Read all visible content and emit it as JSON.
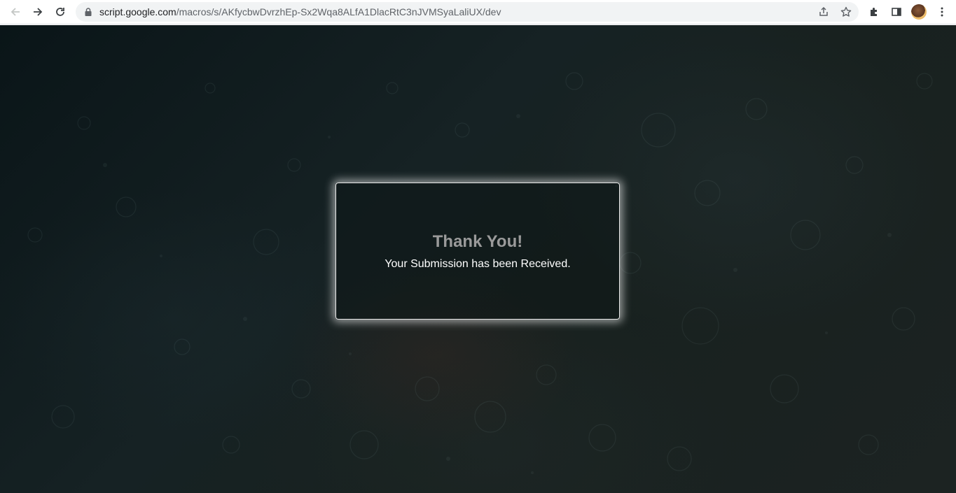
{
  "browser": {
    "url_host": "script.google.com",
    "url_path": "/macros/s/AKfycbwDvrzhEp-Sx2Wqa8ALfA1DlacRtC3nJVMSyaLaliUX/dev",
    "icons": [
      "back-arrow-icon",
      "forward-arrow-icon",
      "reload-icon",
      "lock-icon",
      "share-icon",
      "star-icon",
      "extensions-icon",
      "side-panel-icon",
      "avatar",
      "more-vert-icon"
    ]
  },
  "card": {
    "title": "Thank You!",
    "message": "Your Submission has been Received."
  },
  "colors": {
    "title": "#9a9a9a",
    "message": "#ffffff",
    "card_border": "#e8e8e8",
    "background": "#162224"
  }
}
